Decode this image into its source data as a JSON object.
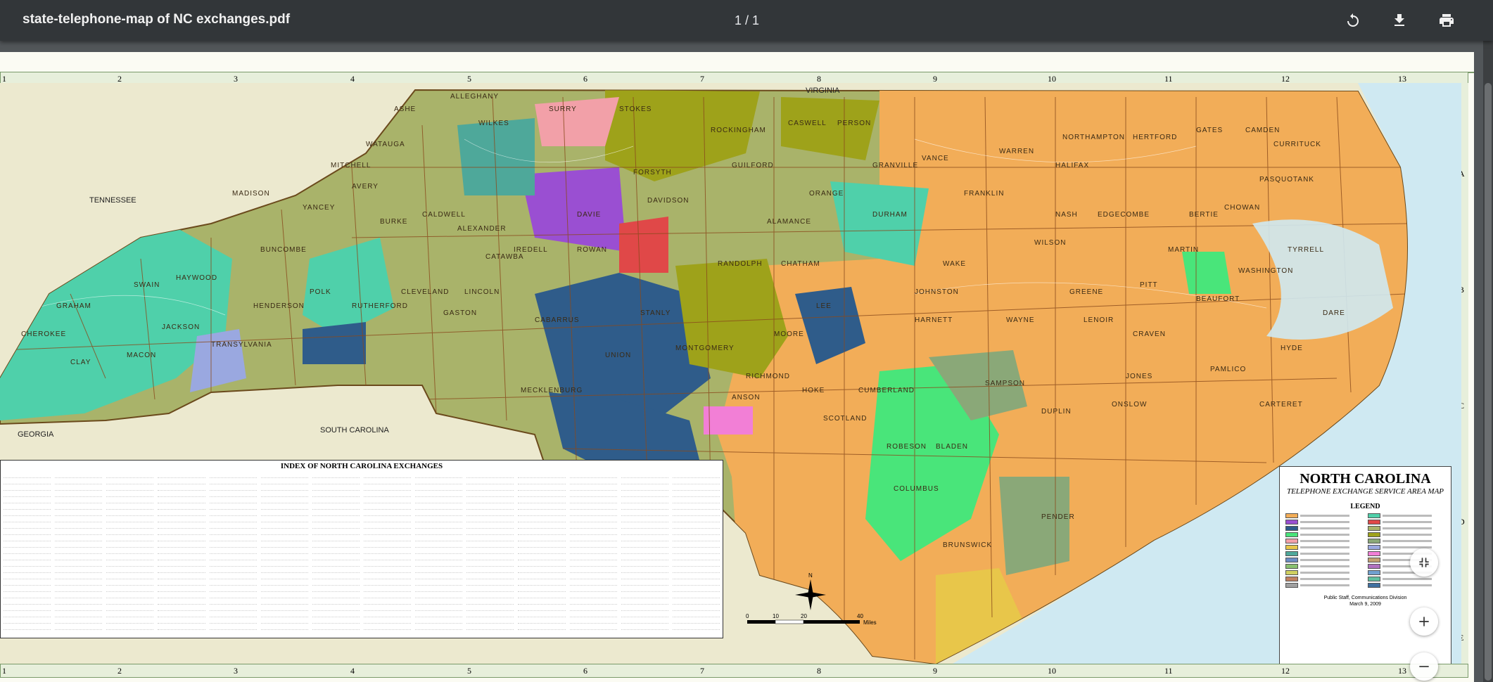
{
  "toolbar": {
    "title": "state-telephone-map of NC exchanges.pdf",
    "page_indicator": "1 / 1"
  },
  "grid": {
    "columns": [
      "1",
      "2",
      "3",
      "4",
      "5",
      "6",
      "7",
      "8",
      "9",
      "10",
      "11",
      "12",
      "13"
    ],
    "rows": [
      "A",
      "B",
      "C",
      "D",
      "E"
    ]
  },
  "map_labels": {
    "virginia": "VIRGINIA",
    "tennessee": "TENNESSEE",
    "georgia": "GEORGIA",
    "south_carolina": "SOUTH CAROLINA",
    "counties": [
      "ALLEGHANY",
      "ASHE",
      "WATAUGA",
      "AVERY",
      "MITCHELL",
      "YANCEY",
      "MADISON",
      "BUNCOMBE",
      "HAYWOOD",
      "SWAIN",
      "GRAHAM",
      "CHEROKEE",
      "CLAY",
      "MACON",
      "JACKSON",
      "TRANSYLVANIA",
      "HENDERSON",
      "POLK",
      "RUTHERFORD",
      "CLEVELAND",
      "GASTON",
      "LINCOLN",
      "CATAWBA",
      "BURKE",
      "CALDWELL",
      "ALEXANDER",
      "IREDELL",
      "WILKES",
      "SURRY",
      "STOKES",
      "ROCKINGHAM",
      "CASWELL",
      "PERSON",
      "GRANVILLE",
      "VANCE",
      "WARREN",
      "NORTHAMPTON",
      "HERTFORD",
      "GATES",
      "CAMDEN",
      "CURRITUCK",
      "PASQUOTANK",
      "CHOWAN",
      "BERTIE",
      "HALIFAX",
      "NASH",
      "FRANKLIN",
      "WAKE",
      "DURHAM",
      "ORANGE",
      "ALAMANCE",
      "GUILFORD",
      "FORSYTH",
      "DAVIDSON",
      "DAVIE",
      "ROWAN",
      "CABARRUS",
      "MECKLENBURG",
      "UNION",
      "STANLY",
      "MONTGOMERY",
      "RANDOLPH",
      "CHATHAM",
      "LEE",
      "MOORE",
      "RICHMOND",
      "HOKE",
      "CUMBERLAND",
      "HARNETT",
      "JOHNSTON",
      "WILSON",
      "EDGECOMBE",
      "MARTIN",
      "WASHINGTON",
      "TYRRELL",
      "DARE",
      "HYDE",
      "BEAUFORT",
      "PITT",
      "GREENE",
      "WAYNE",
      "LENOIR",
      "CRAVEN",
      "JONES",
      "ONSLOW",
      "CARTERET",
      "PAMLICO",
      "DUPLIN",
      "SAMPSON",
      "BLADEN",
      "ROBESON",
      "COLUMBUS",
      "BRUNSWICK",
      "PENDER",
      "SCOTLAND",
      "ANSON"
    ]
  },
  "index": {
    "title": "INDEX OF NORTH CAROLINA EXCHANGES"
  },
  "legend": {
    "title": "NORTH CAROLINA",
    "subtitle": "TELEPHONE EXCHANGE SERVICE AREA MAP",
    "heading": "LEGEND",
    "footer_line1": "Public Staff, Communications Division",
    "footer_line2": "March 9, 2009"
  },
  "scale": {
    "ticks": [
      "0",
      "10",
      "20",
      "40"
    ],
    "unit": "Miles"
  },
  "colors": {
    "toolbar_bg": "#323639",
    "viewer_bg": "#525659",
    "orange_region": "#f2ad58",
    "olive_region": "#a9b36a",
    "teal_region": "#4fd0aa",
    "navy_region": "#2f5c8a",
    "green_region": "#49e57a",
    "purple_region": "#9a4fd2",
    "red_region": "#e04848",
    "water": "#cfe9f2"
  },
  "icons": [
    "rotate-icon",
    "download-icon",
    "print-icon",
    "fit-page-icon",
    "zoom-in-icon",
    "zoom-out-icon"
  ]
}
